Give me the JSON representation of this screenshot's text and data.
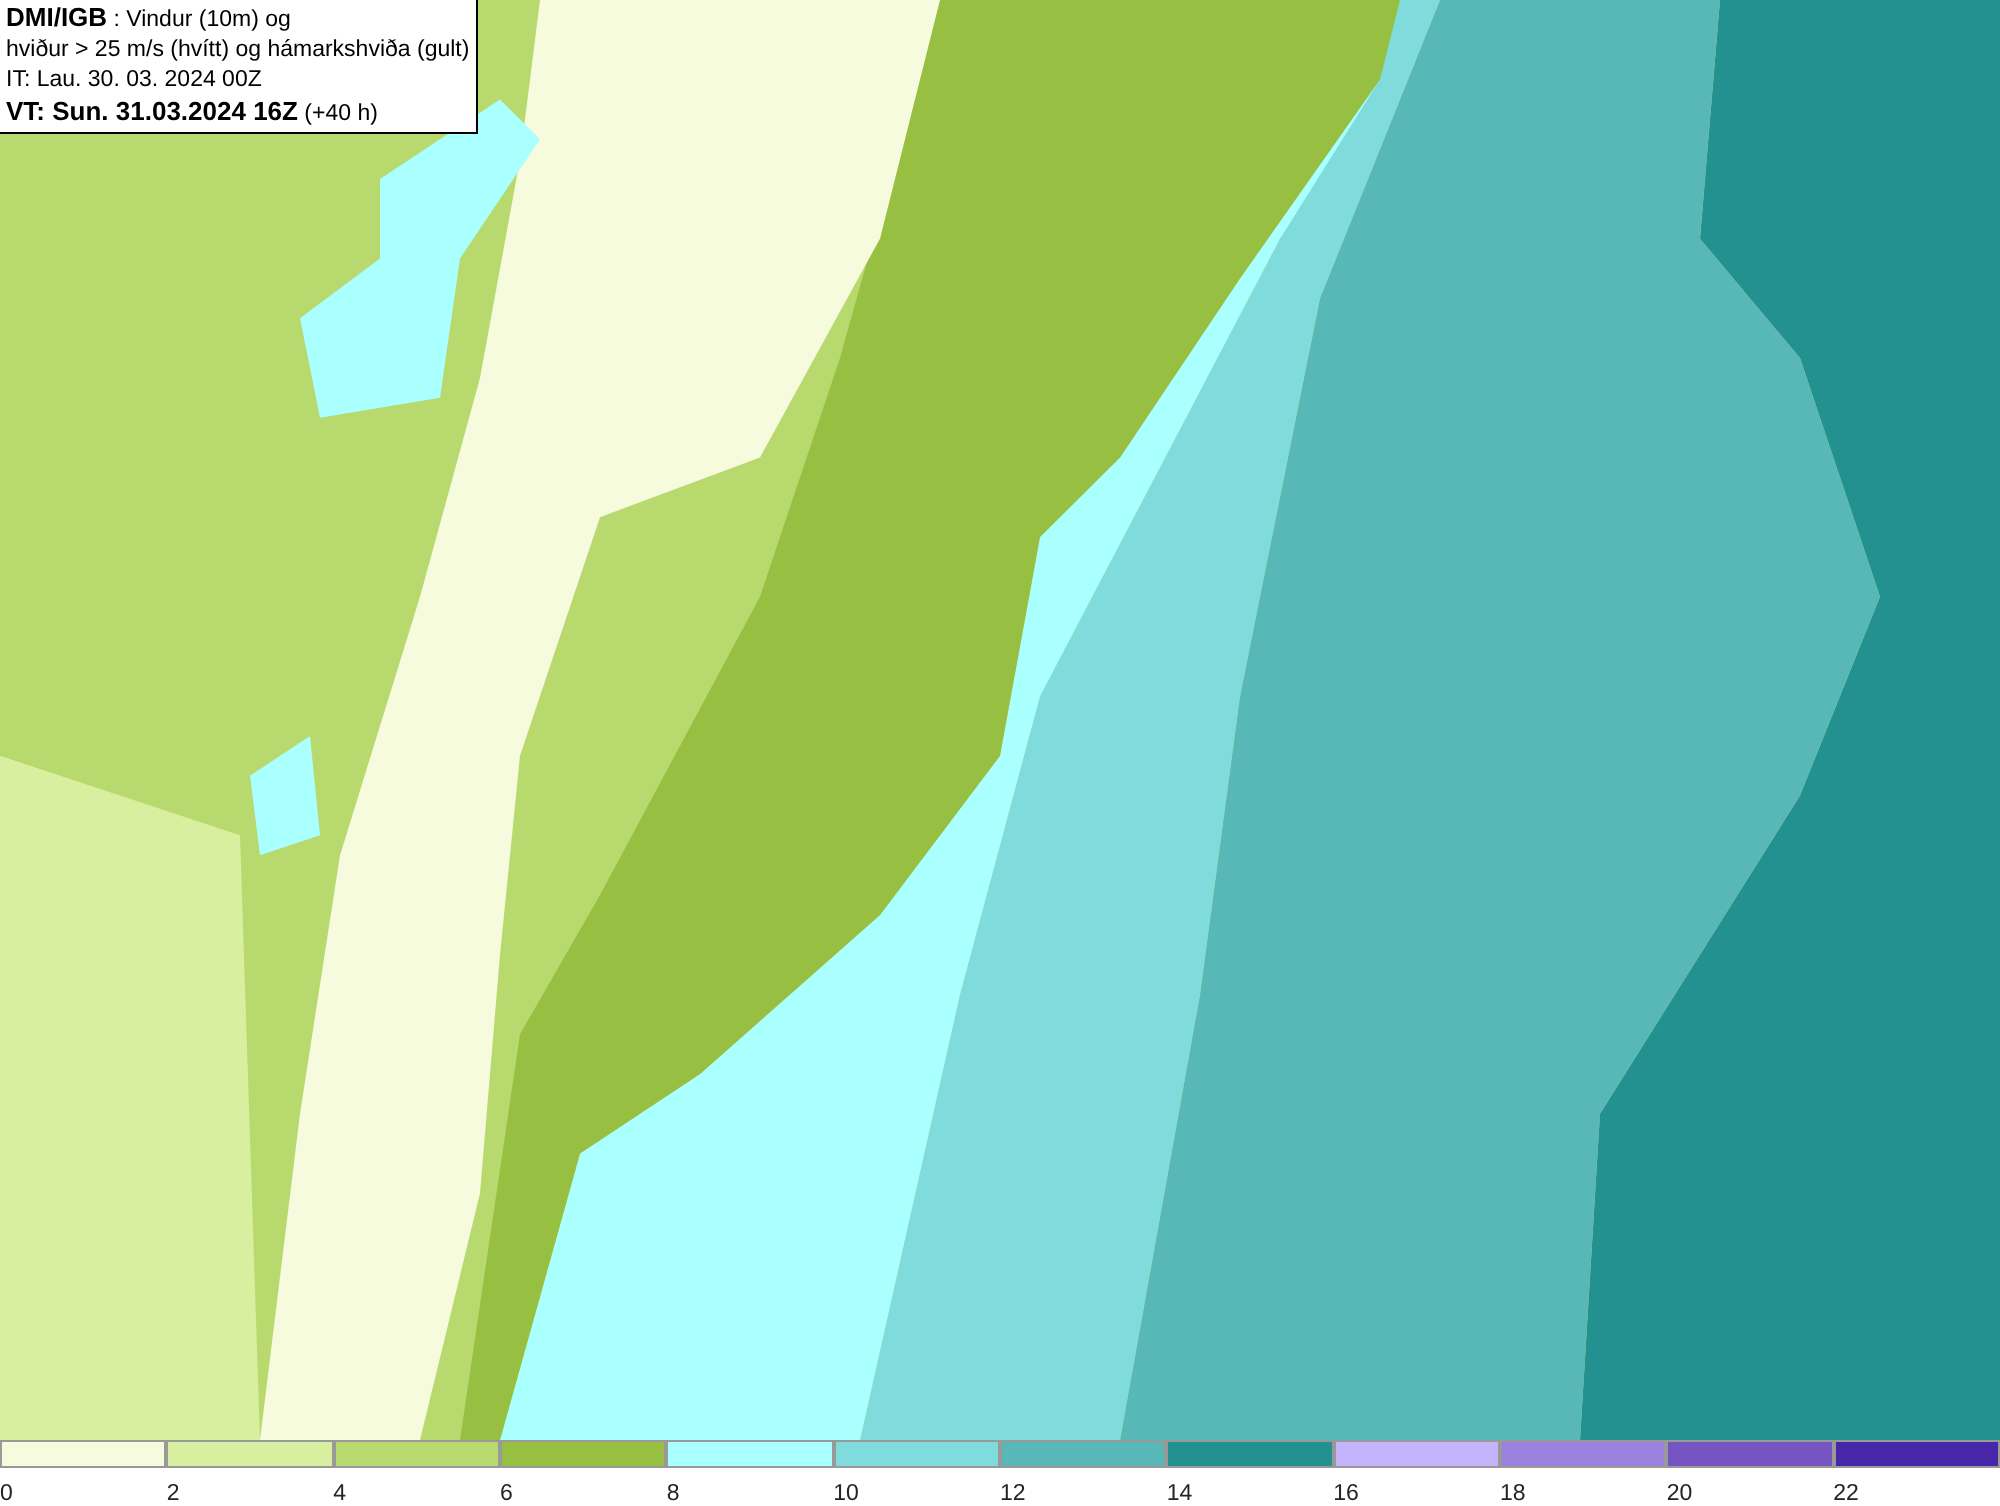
{
  "header": [
    "**DMI/IGB** : Vindur (10m) og",
    "hviður > 25 m/s (hvítt) og hámarkshviða (gult)",
    "IT: Lau. 30. 03. 2024 00Z",
    "**VT: Sun. 31.03.2024 16Z** (+40 h)"
  ],
  "legend": [
    {
      "label": "0",
      "color": "#f5fbdc"
    },
    {
      "label": "2",
      "color": "#d8ef9f"
    },
    {
      "label": "4",
      "color": "#b8d96e"
    },
    {
      "label": "6",
      "color": "#97bf42"
    },
    {
      "label": "8",
      "color": "#aaffff"
    },
    {
      "label": "10",
      "color": "#80dcdc"
    },
    {
      "label": "12",
      "color": "#58b8b8"
    },
    {
      "label": "14",
      "color": "#23918f"
    },
    {
      "label": "16",
      "color": "#c4b4fe"
    },
    {
      "label": "18",
      "color": "#9a82de"
    },
    {
      "label": "20",
      "color": "#7655c2"
    },
    {
      "label": "22",
      "color": "#4826a8"
    }
  ]
}
